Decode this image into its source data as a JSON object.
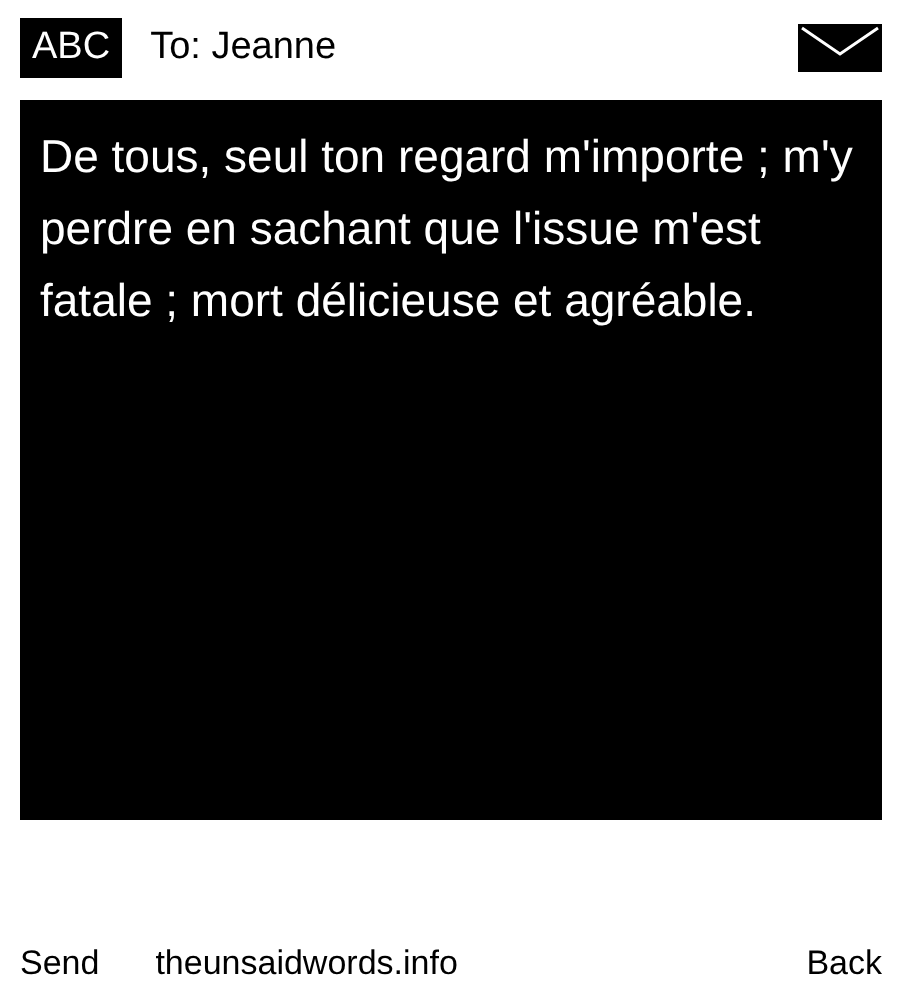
{
  "header": {
    "input_mode": "ABC",
    "recipient": "To: Jeanne"
  },
  "message": {
    "value": "De tous, seul ton regard m'importe ; m'y perdre en sachant que l'issue m'est fatale ; mort délicieuse et agréable."
  },
  "softkeys": {
    "left": "Send",
    "center": "theunsaidwords.info",
    "right": "Back"
  }
}
